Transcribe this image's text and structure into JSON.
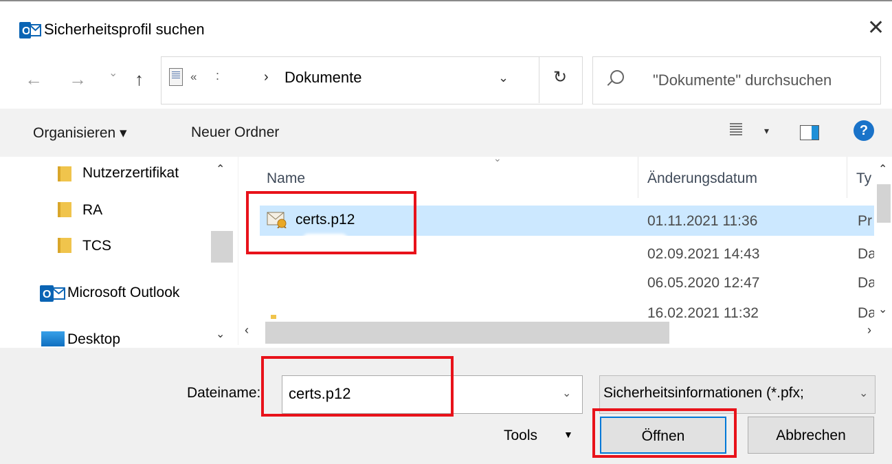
{
  "window": {
    "title": "Sicherheitsprofil suchen",
    "close": "✕",
    "app_icon": "outlook-icon"
  },
  "navbar": {
    "back": "←",
    "forward": "→",
    "recent": "⌄",
    "up": "↑",
    "breadcrumb_overflow": "«",
    "breadcrumb_sep": ":",
    "breadcrumb_arrow": "›",
    "current_folder": "Dokumente",
    "dropdown": "⌄",
    "refresh": "↻",
    "search_placeholder": "\"Dokumente\" durchsuchen"
  },
  "toolbar": {
    "organize": "Organisieren ▾",
    "new_folder": "Neuer Ordner",
    "view_drop": "▾",
    "help": "?"
  },
  "sidebar": {
    "items": [
      {
        "label": "Nutzerzertifikat",
        "icon": "folder-icon"
      },
      {
        "label": "RA",
        "icon": "folder-icon"
      },
      {
        "label": "TCS",
        "icon": "folder-icon"
      },
      {
        "label": "Microsoft Outlook",
        "icon": "outlook-icon"
      },
      {
        "label": "Desktop",
        "icon": "desktop-icon"
      }
    ],
    "scroll_up": "⌃",
    "scroll_down": "⌄"
  },
  "filelist": {
    "columns": [
      "Name",
      "Änderungsdatum",
      "Ty"
    ],
    "sort_indicator": "⌄",
    "rows": [
      {
        "name": "certs.p12",
        "date": "01.11.2021 11:36",
        "type": "Pr",
        "selected": true
      },
      {
        "name": "",
        "date": "02.09.2021 14:43",
        "type": "Da"
      },
      {
        "name": "",
        "date": "06.05.2020 12:47",
        "type": "Da"
      },
      {
        "name": "",
        "date": "16.02.2021 11:32",
        "type": "Da"
      }
    ],
    "scroll_left": "‹",
    "scroll_right": "›",
    "scroll_up": "⌃",
    "scroll_down": "⌄"
  },
  "footer": {
    "filename_label": "Dateiname:",
    "filename_value": "certs.p12",
    "filename_drop": "⌄",
    "filetype": "Sicherheitsinformationen (*.pfx;",
    "filetype_drop": "⌄",
    "tools": "Tools",
    "tools_drop": "▼",
    "open": "Öffnen",
    "cancel": "Abbrechen"
  },
  "colors": {
    "accent": "#0078d7",
    "selection": "#cce8ff",
    "highlight": "#e8121a"
  }
}
